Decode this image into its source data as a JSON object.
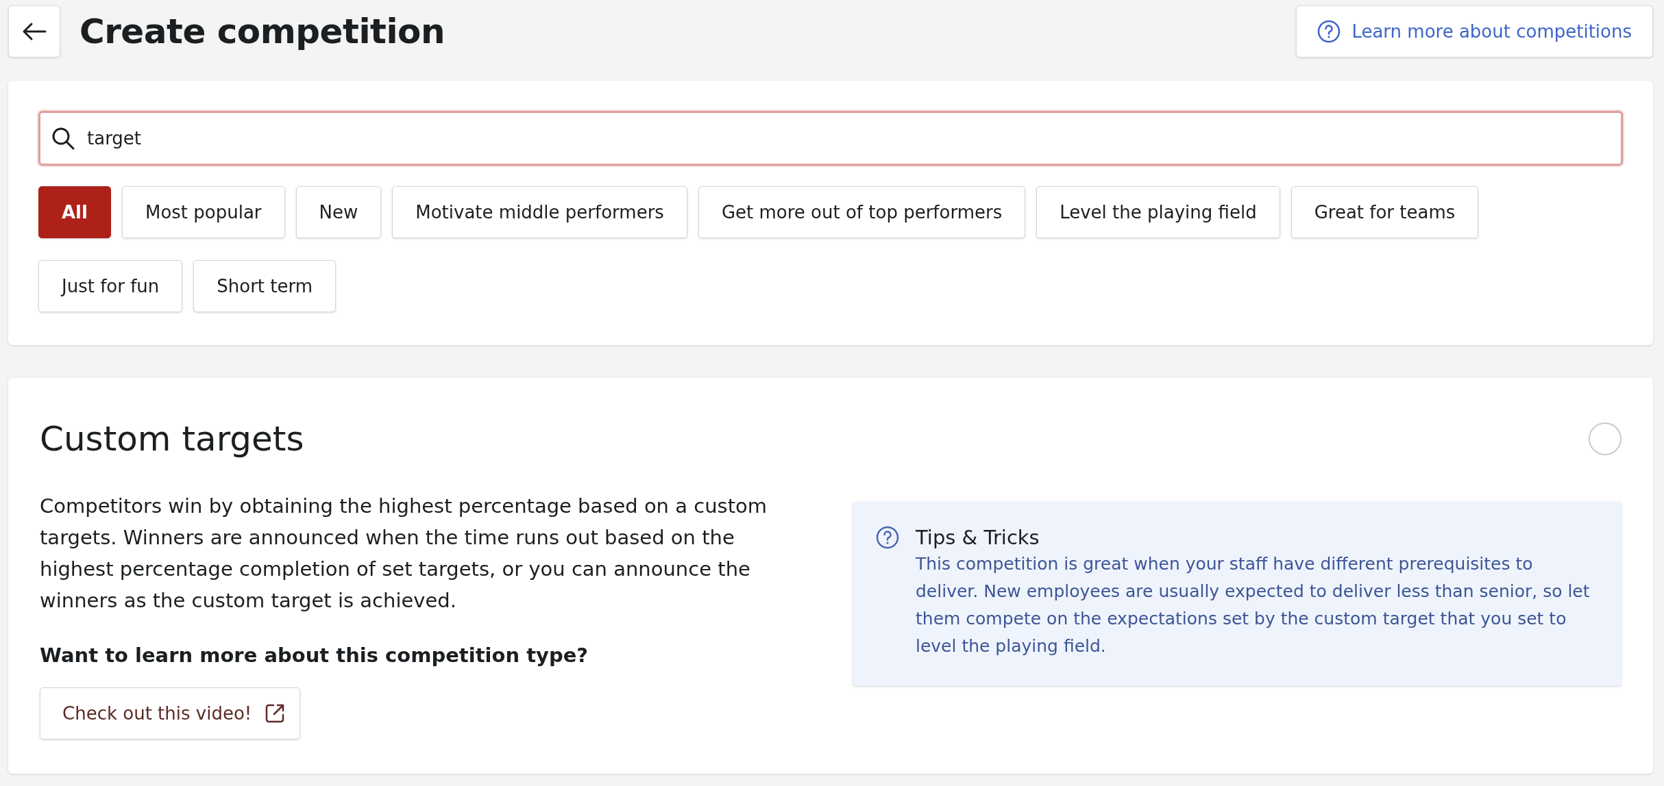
{
  "header": {
    "title": "Create competition",
    "help_link": "Learn more about competitions"
  },
  "search": {
    "value": "target"
  },
  "filters": [
    {
      "label": "All",
      "selected": true
    },
    {
      "label": "Most popular",
      "selected": false
    },
    {
      "label": "New",
      "selected": false
    },
    {
      "label": "Motivate middle performers",
      "selected": false
    },
    {
      "label": "Get more out of top performers",
      "selected": false
    },
    {
      "label": "Level the playing field",
      "selected": false
    },
    {
      "label": "Great for teams",
      "selected": false
    },
    {
      "label": "Just for fun",
      "selected": false
    },
    {
      "label": "Short term",
      "selected": false
    }
  ],
  "competition": {
    "title": "Custom targets",
    "selected": false,
    "description": "Competitors win by obtaining the highest percentage based on a custom targets. Winners are announced when the time runs out based on the highest percentage completion of set targets, or you can announce the winners as the custom target is achieved.",
    "question": "Want to learn more about this competition type?",
    "video_button": "Check out this video!",
    "tips": {
      "title": "Tips & Tricks",
      "text": "This competition is great when your staff have different prerequisites to deliver. New employees are usually expected to deliver less than senior, so let them compete on the expectations set by the custom target that you set to level the playing field."
    }
  }
}
